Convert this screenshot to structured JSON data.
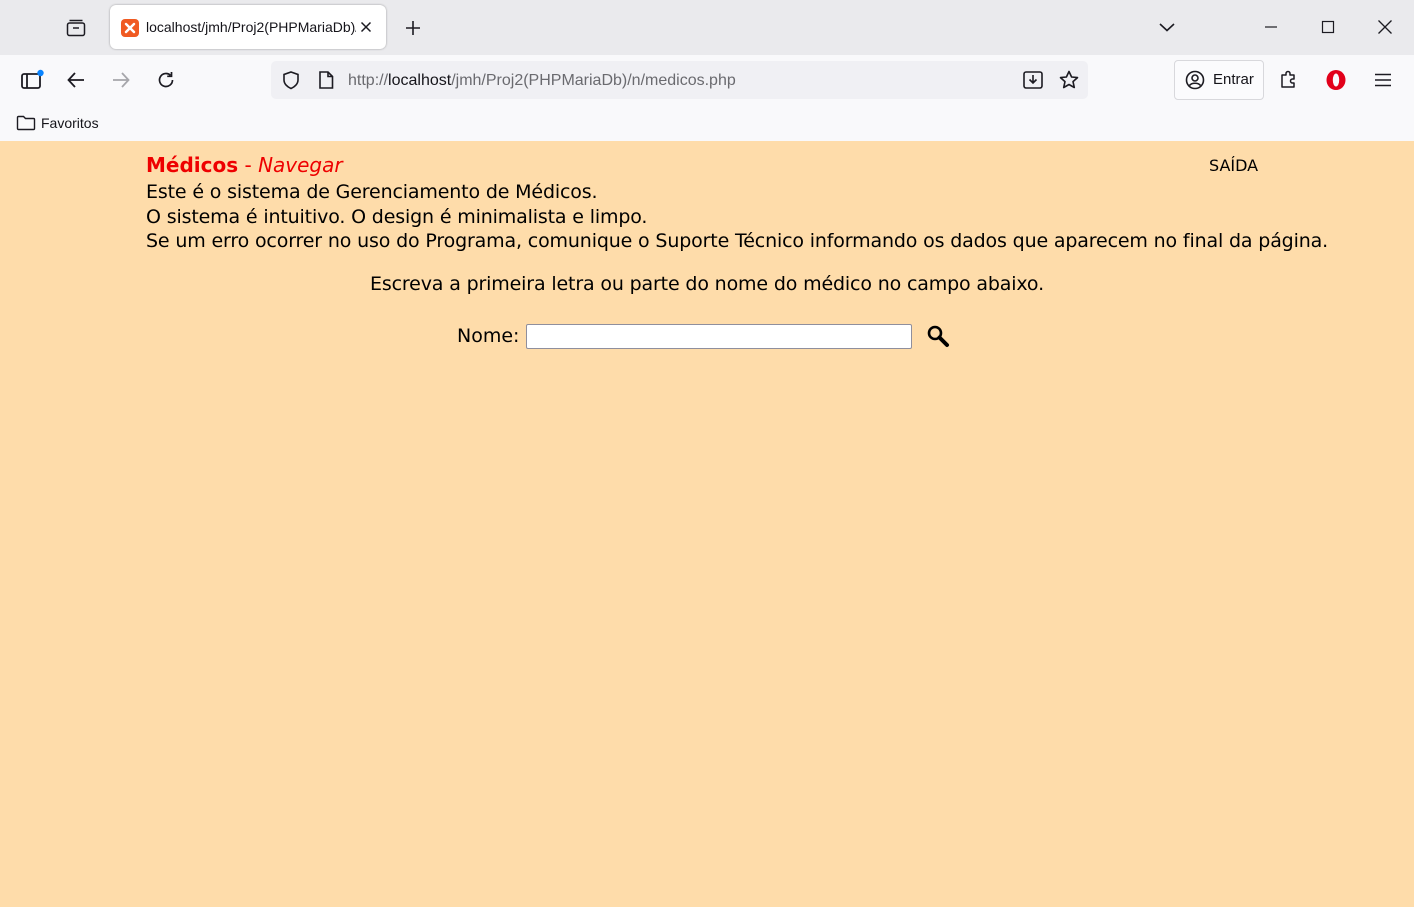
{
  "browser": {
    "tab": {
      "title": "localhost/jmh/Proj2(PHPMariaDb)/n/medicos.php"
    },
    "url": {
      "scheme": "http://",
      "host": "localhost",
      "path": "/jmh/Proj2(PHPMariaDb)/n/medicos.php"
    },
    "signin_label": "Entrar",
    "bookmarks": [
      {
        "label": "Favoritos"
      }
    ]
  },
  "page": {
    "title_main": "Médicos",
    "title_separator": " - ",
    "title_sub": "Navegar",
    "exit_label": "SAÍDA",
    "intro_lines": [
      "Este é o sistema de Gerenciamento de Médicos.",
      "O sistema é intuitivo. O design é minimalista e limpo.",
      "Se um erro ocorrer no uso do Programa, comunique o Suporte Técnico informando os dados que aparecem no final da página."
    ],
    "instruction": "Escreva a primeira letra ou parte do nome do médico no campo abaixo.",
    "search": {
      "label": "Nome:",
      "value": "",
      "placeholder": ""
    }
  },
  "colors": {
    "page_background": "#fedcaa",
    "title_red": "#ee0000",
    "favicon_orange": "#f05a22",
    "opera_red": "#e2001a"
  }
}
